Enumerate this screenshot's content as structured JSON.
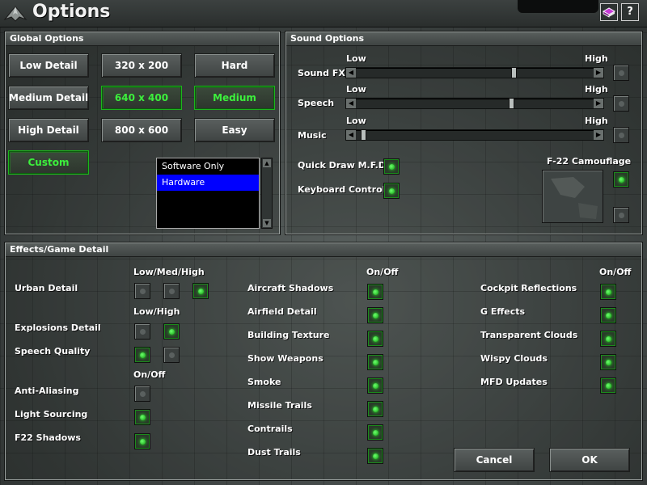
{
  "window": {
    "title": "Options",
    "book_icon": "book-icon",
    "help_label": "?"
  },
  "global": {
    "heading": "Global Options",
    "detail": [
      "Low Detail",
      "Medium Detail",
      "High Detail",
      "Custom"
    ],
    "resolution": [
      "320 x 200",
      "640 x 400",
      "800 x 600"
    ],
    "difficulty": [
      "Hard",
      "Medium",
      "Easy"
    ],
    "selected": {
      "detail": "Custom",
      "resolution": "640 x 400",
      "difficulty": "Medium"
    },
    "renderer": {
      "options": [
        "Software Only",
        "Hardware"
      ],
      "selected": "Hardware"
    }
  },
  "sound": {
    "heading": "Sound Options",
    "low_label": "Low",
    "high_label": "High",
    "sliders": [
      {
        "label": "Sound FX",
        "level": 0.67
      },
      {
        "label": "Speech",
        "level": 0.66
      },
      {
        "label": "Music",
        "level": 0.02
      }
    ],
    "toggles": [
      {
        "label": "Quick Draw M.F.D",
        "on": true
      },
      {
        "label": "Keyboard Control",
        "on": true
      }
    ],
    "camouflage": {
      "label": "F-22 Camouflage",
      "on": true
    }
  },
  "effects": {
    "heading": "Effects/Game Detail",
    "col1": {
      "headers": {
        "lmh": "Low/Med/High",
        "lh": "Low/High",
        "onoff": "On/Off"
      },
      "rows": [
        {
          "label": "Urban Detail",
          "states": [
            false,
            false,
            true
          ]
        },
        {
          "label": "Explosions Detail",
          "states": [
            false,
            true
          ]
        },
        {
          "label": "Speech Quality",
          "states": [
            true,
            false
          ]
        },
        {
          "label": "Anti-Aliasing",
          "states": [
            false
          ]
        },
        {
          "label": "Light Sourcing",
          "states": [
            true
          ]
        },
        {
          "label": "F22 Shadows",
          "states": [
            true
          ]
        }
      ]
    },
    "col2": {
      "header": "On/Off",
      "rows": [
        {
          "label": "Aircraft Shadows",
          "on": true
        },
        {
          "label": "Airfield Detail",
          "on": true
        },
        {
          "label": "Building Texture",
          "on": true
        },
        {
          "label": "Show Weapons",
          "on": true
        },
        {
          "label": "Smoke",
          "on": true
        },
        {
          "label": "Missile Trails",
          "on": true
        },
        {
          "label": "Contrails",
          "on": true
        },
        {
          "label": "Dust Trails",
          "on": true
        }
      ]
    },
    "col3": {
      "header": "On/Off",
      "rows": [
        {
          "label": "Cockpit Reflections",
          "on": true
        },
        {
          "label": "G Effects",
          "on": true
        },
        {
          "label": "Transparent Clouds",
          "on": true
        },
        {
          "label": "Wispy Clouds",
          "on": true
        },
        {
          "label": "MFD Updates",
          "on": true
        }
      ]
    }
  },
  "actions": {
    "cancel": "Cancel",
    "ok": "OK"
  }
}
